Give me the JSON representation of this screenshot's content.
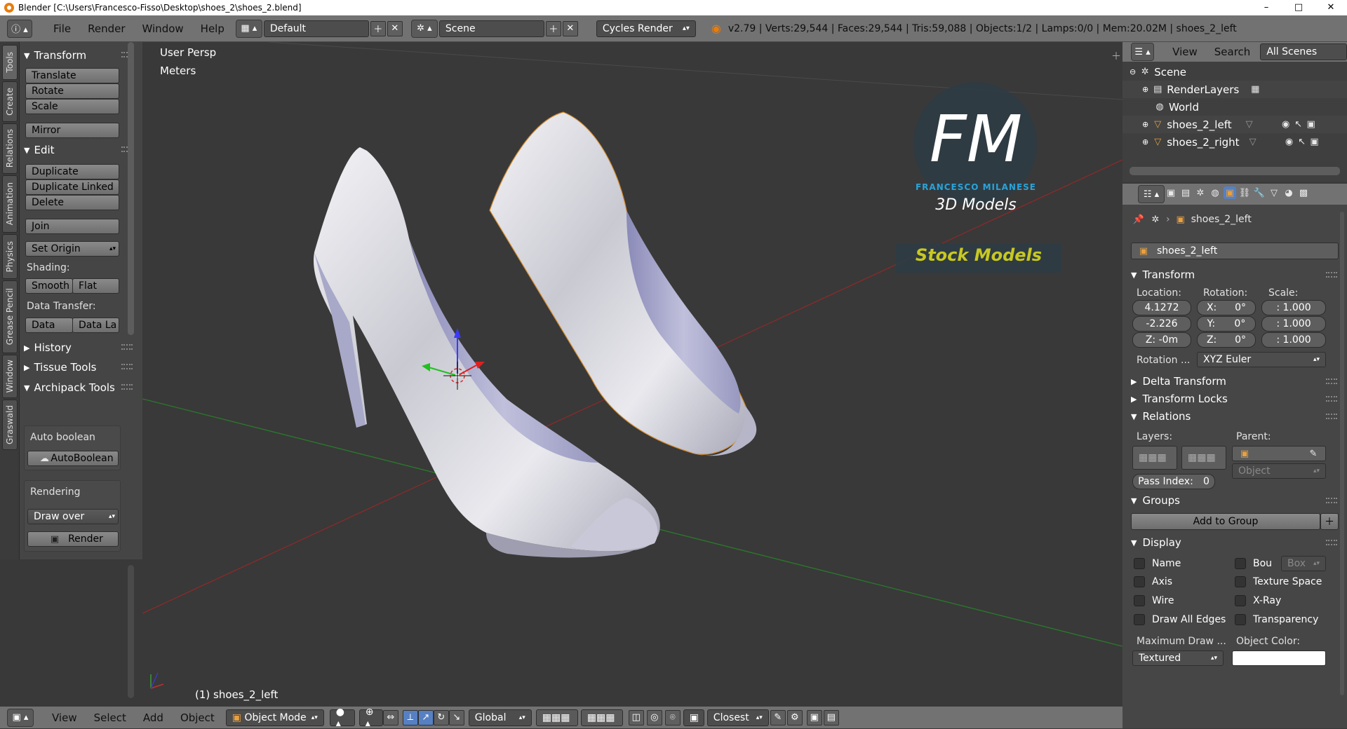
{
  "window": {
    "title": "Blender [C:\\Users\\Francesco-Fisso\\Desktop\\shoes_2\\shoes_2.blend]",
    "minimize": "–",
    "maximize": "□",
    "close": "✕"
  },
  "info": {
    "menus": [
      "File",
      "Render",
      "Window",
      "Help"
    ],
    "layout": "Default",
    "scene": "Scene",
    "engine": "Cycles Render",
    "stats": "v2.79 | Verts:29,544 | Faces:29,544 | Tris:59,088 | Objects:1/2 | Lamps:0/0 | Mem:20.02M | shoes_2_left"
  },
  "left_tabs": [
    "Tools",
    "Create",
    "Relations",
    "Animation",
    "Physics",
    "Grease Pencil",
    "Window",
    "Graswald"
  ],
  "toolshelf": {
    "transform_title": "Transform",
    "translate": "Translate",
    "rotate": "Rotate",
    "scale": "Scale",
    "mirror": "Mirror",
    "edit_title": "Edit",
    "duplicate": "Duplicate",
    "duplicate_linked": "Duplicate Linked",
    "delete": "Delete",
    "join": "Join",
    "set_origin": "Set Origin",
    "shading_label": "Shading:",
    "smooth": "Smooth",
    "flat": "Flat",
    "data_transfer_label": "Data Transfer:",
    "data": "Data",
    "data_la": "Data La",
    "history": "History",
    "tissue_tools": "Tissue Tools",
    "archipack_tools": "Archipack Tools",
    "auto_boolean_label": "Auto boolean",
    "autoboolean": "AutoBoolean",
    "rendering_label": "Rendering",
    "draw_over": "Draw over",
    "render": "Render"
  },
  "viewport": {
    "view_label": "User Persp",
    "units_label": "Meters",
    "object_label": "(1) shoes_2_left",
    "logo_fm": "FM",
    "logo_name": "FRANCESCO MILANESE",
    "logo_sub": "3D Models",
    "logo_stock": "Stock Models"
  },
  "bottombar": {
    "menus": [
      "View",
      "Select",
      "Add",
      "Object"
    ],
    "mode": "Object Mode",
    "orientation": "Global",
    "snap": "Closest"
  },
  "outliner": {
    "menus": [
      "View",
      "Search"
    ],
    "filter": "All Scenes",
    "items": [
      "Scene",
      "RenderLayers",
      "World",
      "shoes_2_left",
      "shoes_2_right"
    ]
  },
  "properties": {
    "breadcrumb_object": "shoes_2_left",
    "object_name": "shoes_2_left",
    "transform_title": "Transform",
    "location_label": "Location:",
    "rotation_label": "Rotation:",
    "scale_label": "Scale:",
    "loc_x": "4.1272",
    "loc_y": "-2.226",
    "loc_z": "Z: -0m",
    "rot_x": "X:",
    "rot_x_val": "0°",
    "rot_y": "Y:",
    "rot_y_val": "0°",
    "rot_z": "Z:",
    "rot_z_val": "0°",
    "scale_x": ": 1.000",
    "scale_y": ": 1.000",
    "scale_z": ": 1.000",
    "rotation_mode_label": "Rotation ...",
    "rotation_mode": "XYZ Euler",
    "delta_transform": "Delta Transform",
    "transform_locks": "Transform Locks",
    "relations_title": "Relations",
    "layers_label": "Layers:",
    "parent_label": "Parent:",
    "parent_type": "Object",
    "pass_index": "Pass Index:",
    "pass_index_val": "0",
    "groups_title": "Groups",
    "add_to_group": "Add to Group",
    "display_title": "Display",
    "name": "Name",
    "bounds": "Bou",
    "bounds_type": "Box",
    "axis": "Axis",
    "texture_space": "Texture Space",
    "wire": "Wire",
    "xray": "X-Ray",
    "draw_all_edges": "Draw All Edges",
    "transparency": "Transparency",
    "max_draw_label": "Maximum Draw ...",
    "object_color_label": "Object Color:",
    "max_draw_val": "Textured"
  }
}
